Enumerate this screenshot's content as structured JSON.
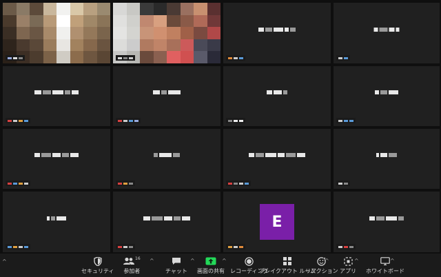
{
  "window": {
    "accent": "#b9e05a",
    "avatar_color": "#7a1fa8"
  },
  "avatar_letter": "E",
  "toolbar": {
    "security": "セキュリティ",
    "participants": "参加者",
    "participants_count": "16",
    "chat": "チャット",
    "share_screen": "画面の共有",
    "recording": "レコーディング",
    "breakout_rooms": "ブレイクアウト ルーム",
    "reactions": "リアクション",
    "apps": "アプリ",
    "whiteboard": "ホワイトボード"
  }
}
